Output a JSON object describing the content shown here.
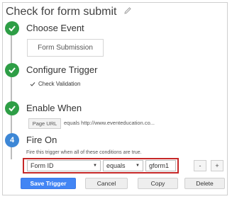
{
  "header": {
    "title": "Check for form submit"
  },
  "steps": [
    {
      "status": "done",
      "title": "Choose Event",
      "event_value": "Form Submission"
    },
    {
      "status": "done",
      "title": "Configure Trigger",
      "option_label": "Check Validation"
    },
    {
      "status": "done",
      "title": "Enable When",
      "variable": "Page URL",
      "condition": "equals http://www.eventeducation.co..."
    },
    {
      "status": "current",
      "number": "4",
      "title": "Fire On",
      "description": "Fire this trigger when all of these conditions are true.",
      "variable": "Form ID",
      "operator": "equals",
      "value": "gform1",
      "remove_label": "-",
      "add_label": "+"
    }
  ],
  "footer": {
    "save_label": "Save Trigger",
    "cancel_label": "Cancel",
    "copy_label": "Copy",
    "delete_label": "Delete"
  },
  "colors": {
    "accent": "#4285f4",
    "done": "#2e9e46",
    "current": "#3d87d6",
    "highlight": "#c62828"
  }
}
